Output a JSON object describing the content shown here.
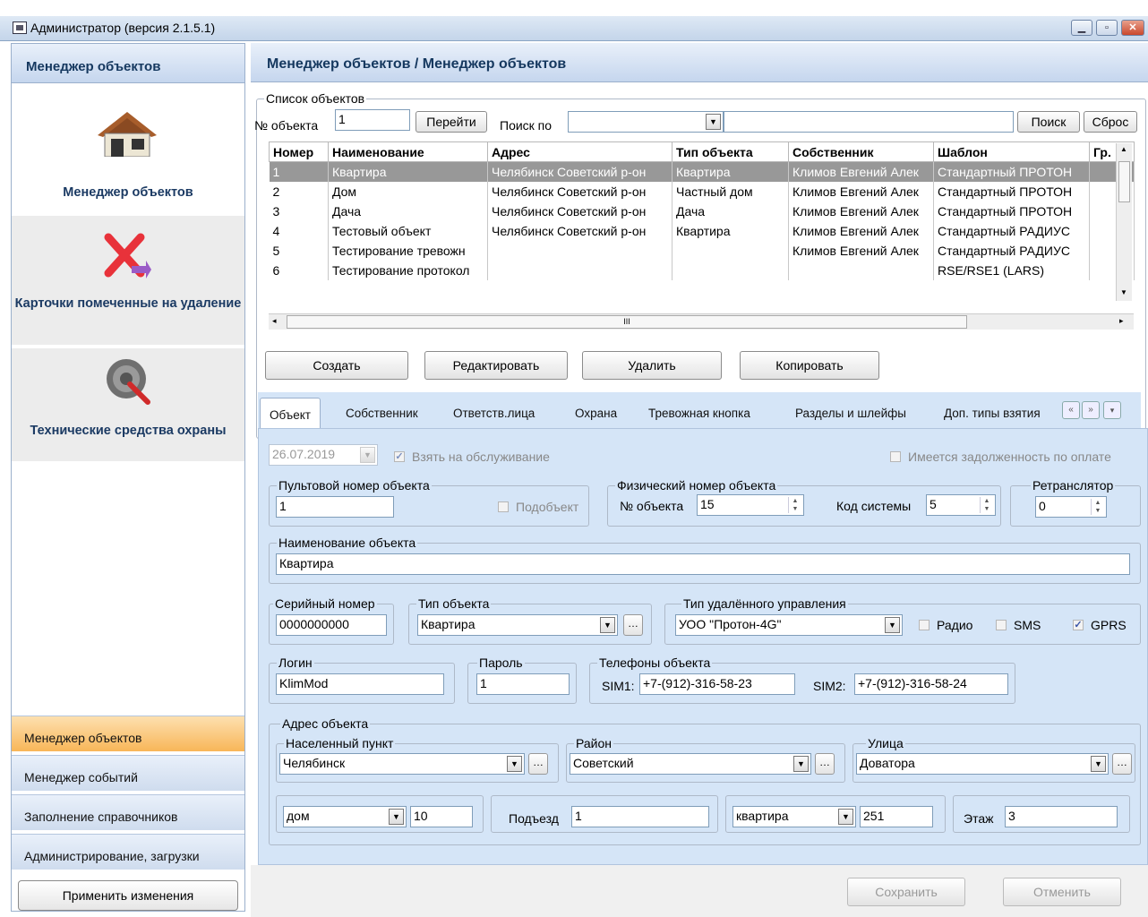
{
  "window": {
    "title": "Администратор (версия 2.1.5.1)"
  },
  "sidebar": {
    "header": "Менеджер объектов",
    "tiles": [
      {
        "label": "Менеджер объектов",
        "icon": "house-icon"
      },
      {
        "label": "Карточки помеченные на удаление",
        "icon": "delete-cross-icon"
      },
      {
        "label": "Технические средства охраны",
        "icon": "tools-icon"
      }
    ],
    "nav": [
      "Менеджер объектов",
      "Менеджер событий",
      "Заполнение справочников",
      "Администрирование, загрузки"
    ],
    "apply_label": "Применить изменения"
  },
  "main": {
    "title": "Менеджер объектов / Менеджер объектов",
    "list": {
      "legend": "Список объектов",
      "obj_no_label": "№ объекта",
      "obj_no_value": "1",
      "goto_label": "Перейти",
      "search_by_label": "Поиск по",
      "search_by_value": "",
      "search_value": "",
      "search_label": "Поиск",
      "reset_label": "Сброс",
      "columns": [
        "Номер",
        "Наименование",
        "Адрес",
        "Тип объекта",
        "Собственник",
        "Шаблон",
        "Гр."
      ],
      "rows": [
        [
          "1",
          "Квартира",
          "Челябинск Советский р-он",
          "Квартира",
          "Климов Евгений Алек",
          "Стандартный ПРОТОН",
          ""
        ],
        [
          "2",
          "Дом",
          "Челябинск Советский р-он",
          "Частный дом",
          "Климов Евгений Алек",
          "Стандартный ПРОТОН",
          ""
        ],
        [
          "3",
          "Дача",
          "Челябинск Советский р-он",
          "Дача",
          "Климов Евгений Алек",
          "Стандартный ПРОТОН",
          ""
        ],
        [
          "4",
          "Тестовый объект",
          "Челябинск Советский р-он",
          "Квартира",
          "Климов Евгений Алек",
          "Стандартный РАДИУС",
          ""
        ],
        [
          "5",
          "Тестирование тревожн",
          "",
          "",
          "Климов Евгений Алек",
          "Стандартный РАДИУС",
          ""
        ],
        [
          "6",
          "Тестирование протокол",
          "",
          "",
          "",
          "RSE/RSE1 (LARS)",
          ""
        ]
      ],
      "scroll_mark": "III"
    },
    "actions": {
      "create": "Создать",
      "edit": "Редактировать",
      "delete": "Удалить",
      "copy": "Копировать"
    },
    "tabs": [
      "Объект",
      "Собственник",
      "Ответств.лица",
      "Охрана",
      "Тревожная кнопка",
      "Разделы и шлейфы",
      "Доп. типы взятия"
    ],
    "form": {
      "date": "26.07.2019",
      "service_label": "Взять на обслуживание",
      "debt_label": "Имеется задолженность по оплате",
      "console_legend": "Пультовой номер объекта",
      "console_value": "1",
      "subobject_label": "Подобъект",
      "phys_legend": "Физический номер объекта",
      "phys_no_label": "№ объекта",
      "phys_no_value": "15",
      "syscode_label": "Код системы",
      "syscode_value": "5",
      "relay_legend": "Ретранслятор",
      "relay_value": "0",
      "name_legend": "Наименование объекта",
      "name_value": "Квартира",
      "serial_legend": "Серийный номер",
      "serial_value": "0000000000",
      "type_legend": "Тип объекта",
      "type_value": "Квартира",
      "remote_legend": "Тип удалённого управления",
      "remote_value": "УОО \"Протон-4G\"",
      "radio_label": "Радио",
      "sms_label": "SMS",
      "gprs_label": "GPRS",
      "login_legend": "Логин",
      "login_value": "KlimMod",
      "password_legend": "Пароль",
      "password_value": "1",
      "phones_legend": "Телефоны объекта",
      "sim1_label": "SIM1:",
      "sim1_value": "+7-(912)-316-58-23",
      "sim2_label": "SIM2:",
      "sim2_value": "+7-(912)-316-58-24",
      "address_legend": "Адрес объекта",
      "city_legend": "Населенный пункт",
      "city_value": "Челябинск",
      "district_legend": "Район",
      "district_value": "Советский",
      "street_legend": "Улица",
      "street_value": "Доватора",
      "house_type": "дом",
      "house_no": "10",
      "entrance_label": "Подъезд",
      "entrance_value": "1",
      "apt_type": "квартира",
      "apt_no": "251",
      "floor_label": "Этаж",
      "floor_value": "3"
    },
    "footer": {
      "save": "Сохранить",
      "cancel": "Отменить"
    }
  }
}
